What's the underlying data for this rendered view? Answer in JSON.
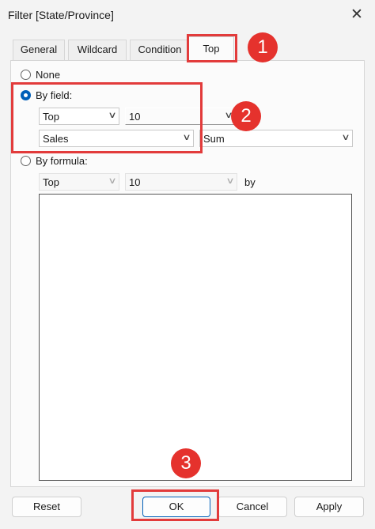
{
  "window": {
    "title": "Filter [State/Province]",
    "close_glyph": "✕"
  },
  "tabs": [
    {
      "label": "General"
    },
    {
      "label": "Wildcard"
    },
    {
      "label": "Condition"
    },
    {
      "label": "Top",
      "active": true
    }
  ],
  "options": {
    "none_label": "None",
    "by_field_label": "By field:",
    "by_formula_label": "By formula:",
    "selected": "by_field"
  },
  "by_field": {
    "direction": "Top",
    "count": "10",
    "field": "Sales",
    "aggregation": "Sum"
  },
  "by_formula": {
    "direction": "Top",
    "count": "10",
    "by_label": "by"
  },
  "buttons": {
    "reset": "Reset",
    "ok": "OK",
    "cancel": "Cancel",
    "apply": "Apply"
  },
  "annotations": [
    "1",
    "2",
    "3"
  ],
  "colors": {
    "accent": "#005fb8",
    "annotation": "#e5322d"
  }
}
